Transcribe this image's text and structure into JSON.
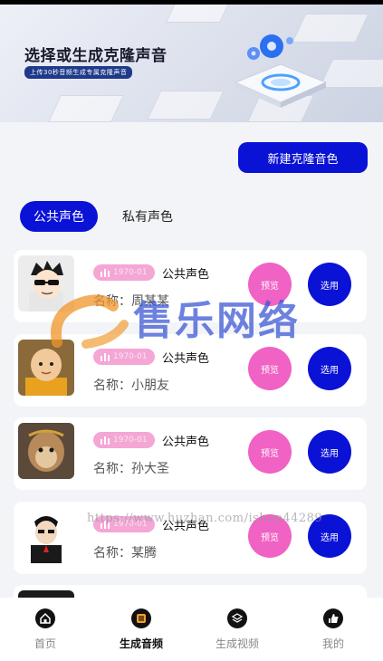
{
  "banner": {
    "title": "选择或生成克隆声音",
    "subtitle": "上传30秒音频生成专属克隆声音"
  },
  "actions": {
    "new_clone": "新建克隆音色"
  },
  "tabs": [
    {
      "label": "公共声色",
      "active": true
    },
    {
      "label": "私有声色",
      "active": false
    }
  ],
  "voices": [
    {
      "date": "1970-01",
      "type": "公共声色",
      "name": "名称：周某某",
      "preview": "预览",
      "select": "选用",
      "avatar": "cartoon-sunglasses-avatar"
    },
    {
      "date": "1970-01",
      "type": "公共声色",
      "name": "名称：小朋友",
      "preview": "预览",
      "select": "选用",
      "avatar": "child-avatar"
    },
    {
      "date": "1970-01",
      "type": "公共声色",
      "name": "名称：孙大圣",
      "preview": "预览",
      "select": "选用",
      "avatar": "monkey-king-avatar"
    },
    {
      "date": "1970-01",
      "type": "公共声色",
      "name": "名称：某腾",
      "preview": "预览",
      "select": "选用",
      "avatar": "cartoon-man-avatar"
    }
  ],
  "watermark": {
    "logo_text": "售乐网络",
    "url": "https://www.huzhan.com/ishop44289"
  },
  "tabbar": [
    {
      "label": "首页",
      "icon": "home-icon",
      "active": false
    },
    {
      "label": "生成音频",
      "icon": "audio-icon",
      "active": true
    },
    {
      "label": "生成视频",
      "icon": "layers-icon",
      "active": false
    },
    {
      "label": "我的",
      "icon": "thumbs-up-icon",
      "active": false
    }
  ],
  "colors": {
    "primary": "#0a12d6",
    "preview": "#f062c3",
    "badge": "#f4a6d5",
    "background": "#f3f4f8"
  }
}
